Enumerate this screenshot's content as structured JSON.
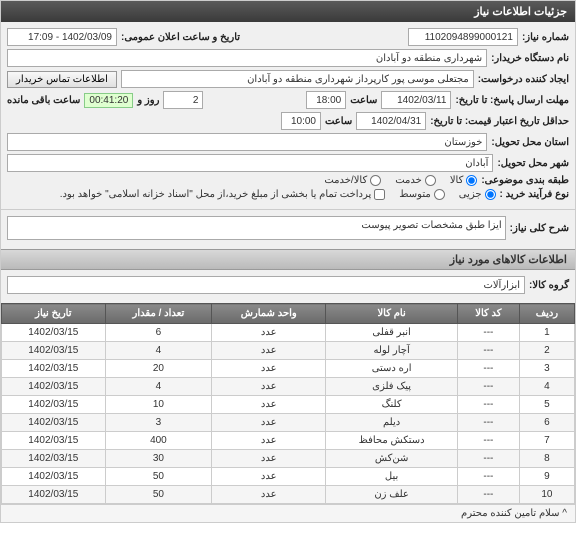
{
  "header": {
    "title": "جزئیات اطلاعات نیاز"
  },
  "form": {
    "need_no_label": "شماره نیاز:",
    "need_no": "1102094899000121",
    "announce_label": "تاریخ و ساعت اعلان عمومی:",
    "announce_val": "1402/03/09 - 17:09",
    "buyer_label": "نام دستگاه خریدار:",
    "buyer_val": "شهرداری منطقه دو آبادان",
    "requester_label": "ایجاد کننده درخواست:",
    "requester_val": "مجتعلی موسی پور کارپرداز شهرداری منطقه دو آبادان",
    "contact_btn": "اطلاعات تماس خریدار",
    "deadline_label": "مهلت ارسال پاسخ: تا تاریخ:",
    "deadline_date": "1402/03/11",
    "time_label": "ساعت",
    "deadline_time": "18:00",
    "days_val": "2",
    "days_label": "روز و",
    "timer": "00:41:20",
    "remain_label": "ساعت باقی مانده",
    "valid_label": "حداقل تاریخ اعتبار قیمت: تا تاریخ:",
    "valid_date": "1402/04/31",
    "valid_time": "10:00",
    "province_label": "استان محل تحویل:",
    "province_val": "خوزستان",
    "city_label": "شهر محل تحویل:",
    "city_val": "آبادان",
    "category_label": "طبقه بندی موضوعی:",
    "cat_goods": "کالا",
    "cat_service": "خدمت",
    "cat_both": "کالا/خدمت",
    "buy_type_label": "نوع فرآیند خرید :",
    "bt_major": "جزیی",
    "bt_medium": "متوسط",
    "payment_note": "پرداخت تمام یا بخشی از مبلغ خرید،از محل \"اسناد خزانه اسلامی\" خواهد بود."
  },
  "desc": {
    "label": "شرح کلی نیاز:",
    "text": "ایزا طبق مشخصات تصویر پیوست"
  },
  "goods": {
    "section": "اطلاعات کالاهای مورد نیاز",
    "group_label": "گروه کالا:",
    "group_val": "ابزارآلات"
  },
  "table": {
    "headers": {
      "row": "ردیف",
      "code": "کد کالا",
      "name": "نام کالا",
      "unit": "واحد شمارش",
      "qty": "تعداد / مقدار",
      "date": "تاریخ نیاز"
    },
    "rows": [
      {
        "r": "1",
        "code": "---",
        "name": "انبر قفلی",
        "unit": "عدد",
        "qty": "6",
        "date": "1402/03/15"
      },
      {
        "r": "2",
        "code": "---",
        "name": "آچار لوله",
        "unit": "عدد",
        "qty": "4",
        "date": "1402/03/15"
      },
      {
        "r": "3",
        "code": "---",
        "name": "اره دستی",
        "unit": "عدد",
        "qty": "20",
        "date": "1402/03/15"
      },
      {
        "r": "4",
        "code": "---",
        "name": "پیک فلزی",
        "unit": "عدد",
        "qty": "4",
        "date": "1402/03/15"
      },
      {
        "r": "5",
        "code": "---",
        "name": "کلنگ",
        "unit": "عدد",
        "qty": "10",
        "date": "1402/03/15"
      },
      {
        "r": "6",
        "code": "---",
        "name": "دیلم",
        "unit": "عدد",
        "qty": "3",
        "date": "1402/03/15"
      },
      {
        "r": "7",
        "code": "---",
        "name": "دستکش محافظ",
        "unit": "عدد",
        "qty": "400",
        "date": "1402/03/15"
      },
      {
        "r": "8",
        "code": "---",
        "name": "شن‌کش",
        "unit": "عدد",
        "qty": "30",
        "date": "1402/03/15"
      },
      {
        "r": "9",
        "code": "---",
        "name": "بیل",
        "unit": "عدد",
        "qty": "50",
        "date": "1402/03/15"
      },
      {
        "r": "10",
        "code": "---",
        "name": "علف زن",
        "unit": "عدد",
        "qty": "50",
        "date": "1402/03/15"
      }
    ]
  },
  "chat": {
    "text": "^ سلام تامین کننده محترم"
  }
}
